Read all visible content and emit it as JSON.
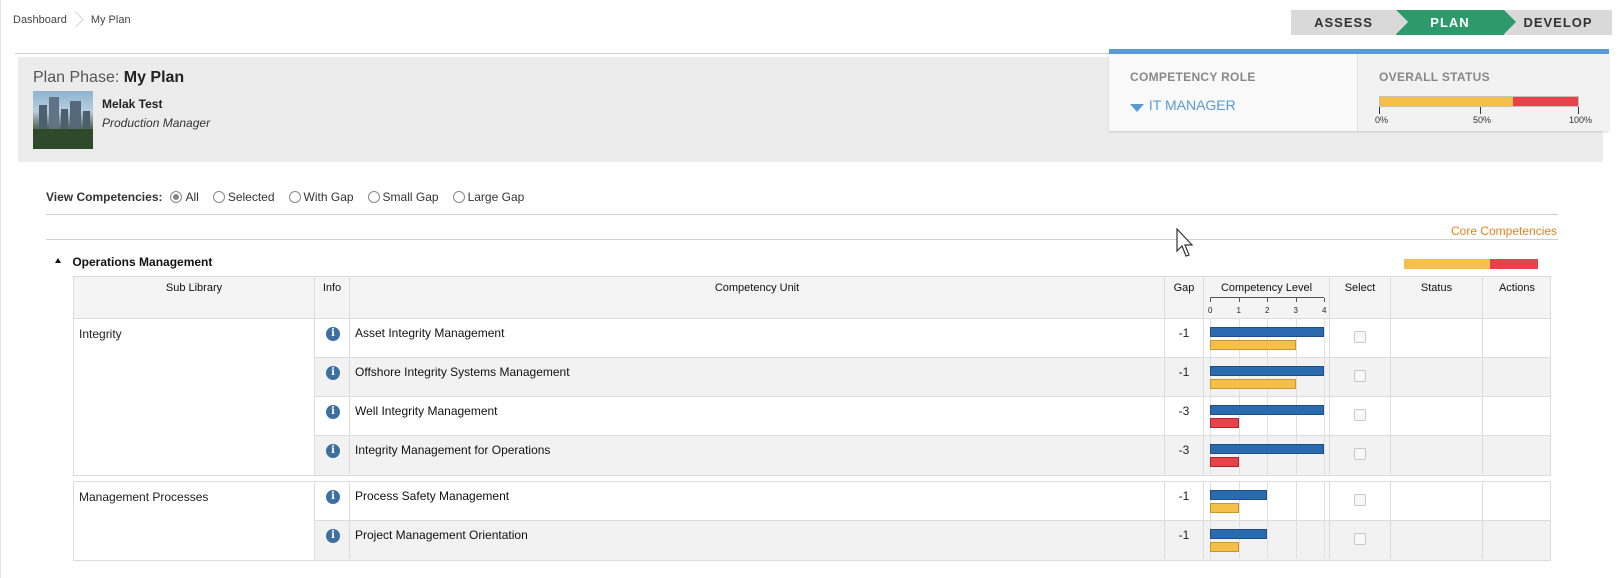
{
  "breadcrumb": {
    "items": [
      "Dashboard",
      "My Plan"
    ]
  },
  "phases": [
    "ASSESS",
    "PLAN",
    "DEVELOP"
  ],
  "active_phase": "PLAN",
  "header": {
    "plan_phase_label": "Plan Phase:",
    "plan_name": "My Plan",
    "user_name": "Melak Test",
    "user_role": "Production Manager"
  },
  "competency_role": {
    "label": "COMPETENCY ROLE",
    "value": "IT MANAGER"
  },
  "overall_status": {
    "label": "OVERALL STATUS",
    "segments": [
      {
        "color": "#f5c04a",
        "fraction": 0.67
      },
      {
        "color": "#e8434a",
        "fraction": 0.33
      }
    ],
    "ticks": [
      "0%",
      "50%",
      "100%"
    ]
  },
  "view": {
    "label": "View Competencies:",
    "options": [
      "All",
      "Selected",
      "With Gap",
      "Small Gap",
      "Large Gap"
    ],
    "selected": "All"
  },
  "core_link": "Core Competencies",
  "section": {
    "title": "Operations Management",
    "bar": [
      {
        "color": "#f5c04a",
        "fraction": 0.64
      },
      {
        "color": "#e8434a",
        "fraction": 0.36
      }
    ]
  },
  "table": {
    "headers": {
      "sub_library": "Sub Library",
      "info": "Info",
      "unit": "Competency Unit",
      "gap": "Gap",
      "level": "Competency Level",
      "select": "Select",
      "status": "Status",
      "actions": "Actions"
    },
    "scale_ticks": [
      "0",
      "1",
      "2",
      "3",
      "4"
    ],
    "scale_max": 4,
    "groups": [
      {
        "sub_library": "Integrity",
        "rows": [
          {
            "unit": "Asset Integrity Management",
            "gap": "-1",
            "required": 4,
            "current": 3,
            "current_color": "#f5c04a"
          },
          {
            "unit": "Offshore Integrity Systems Management",
            "gap": "-1",
            "required": 4,
            "current": 3,
            "current_color": "#f5c04a"
          },
          {
            "unit": "Well Integrity Management",
            "gap": "-3",
            "required": 4,
            "current": 1,
            "current_color": "#e8434a"
          },
          {
            "unit": "Integrity Management for Operations",
            "gap": "-3",
            "required": 4,
            "current": 1,
            "current_color": "#e8434a"
          }
        ]
      },
      {
        "sub_library": "Management Processes",
        "rows": [
          {
            "unit": "Process Safety Management",
            "gap": "-1",
            "required": 2,
            "current": 1,
            "current_color": "#f5c04a"
          },
          {
            "unit": "Project Management Orientation",
            "gap": "-1",
            "required": 2,
            "current": 1,
            "current_color": "#f5c04a"
          }
        ]
      }
    ]
  }
}
